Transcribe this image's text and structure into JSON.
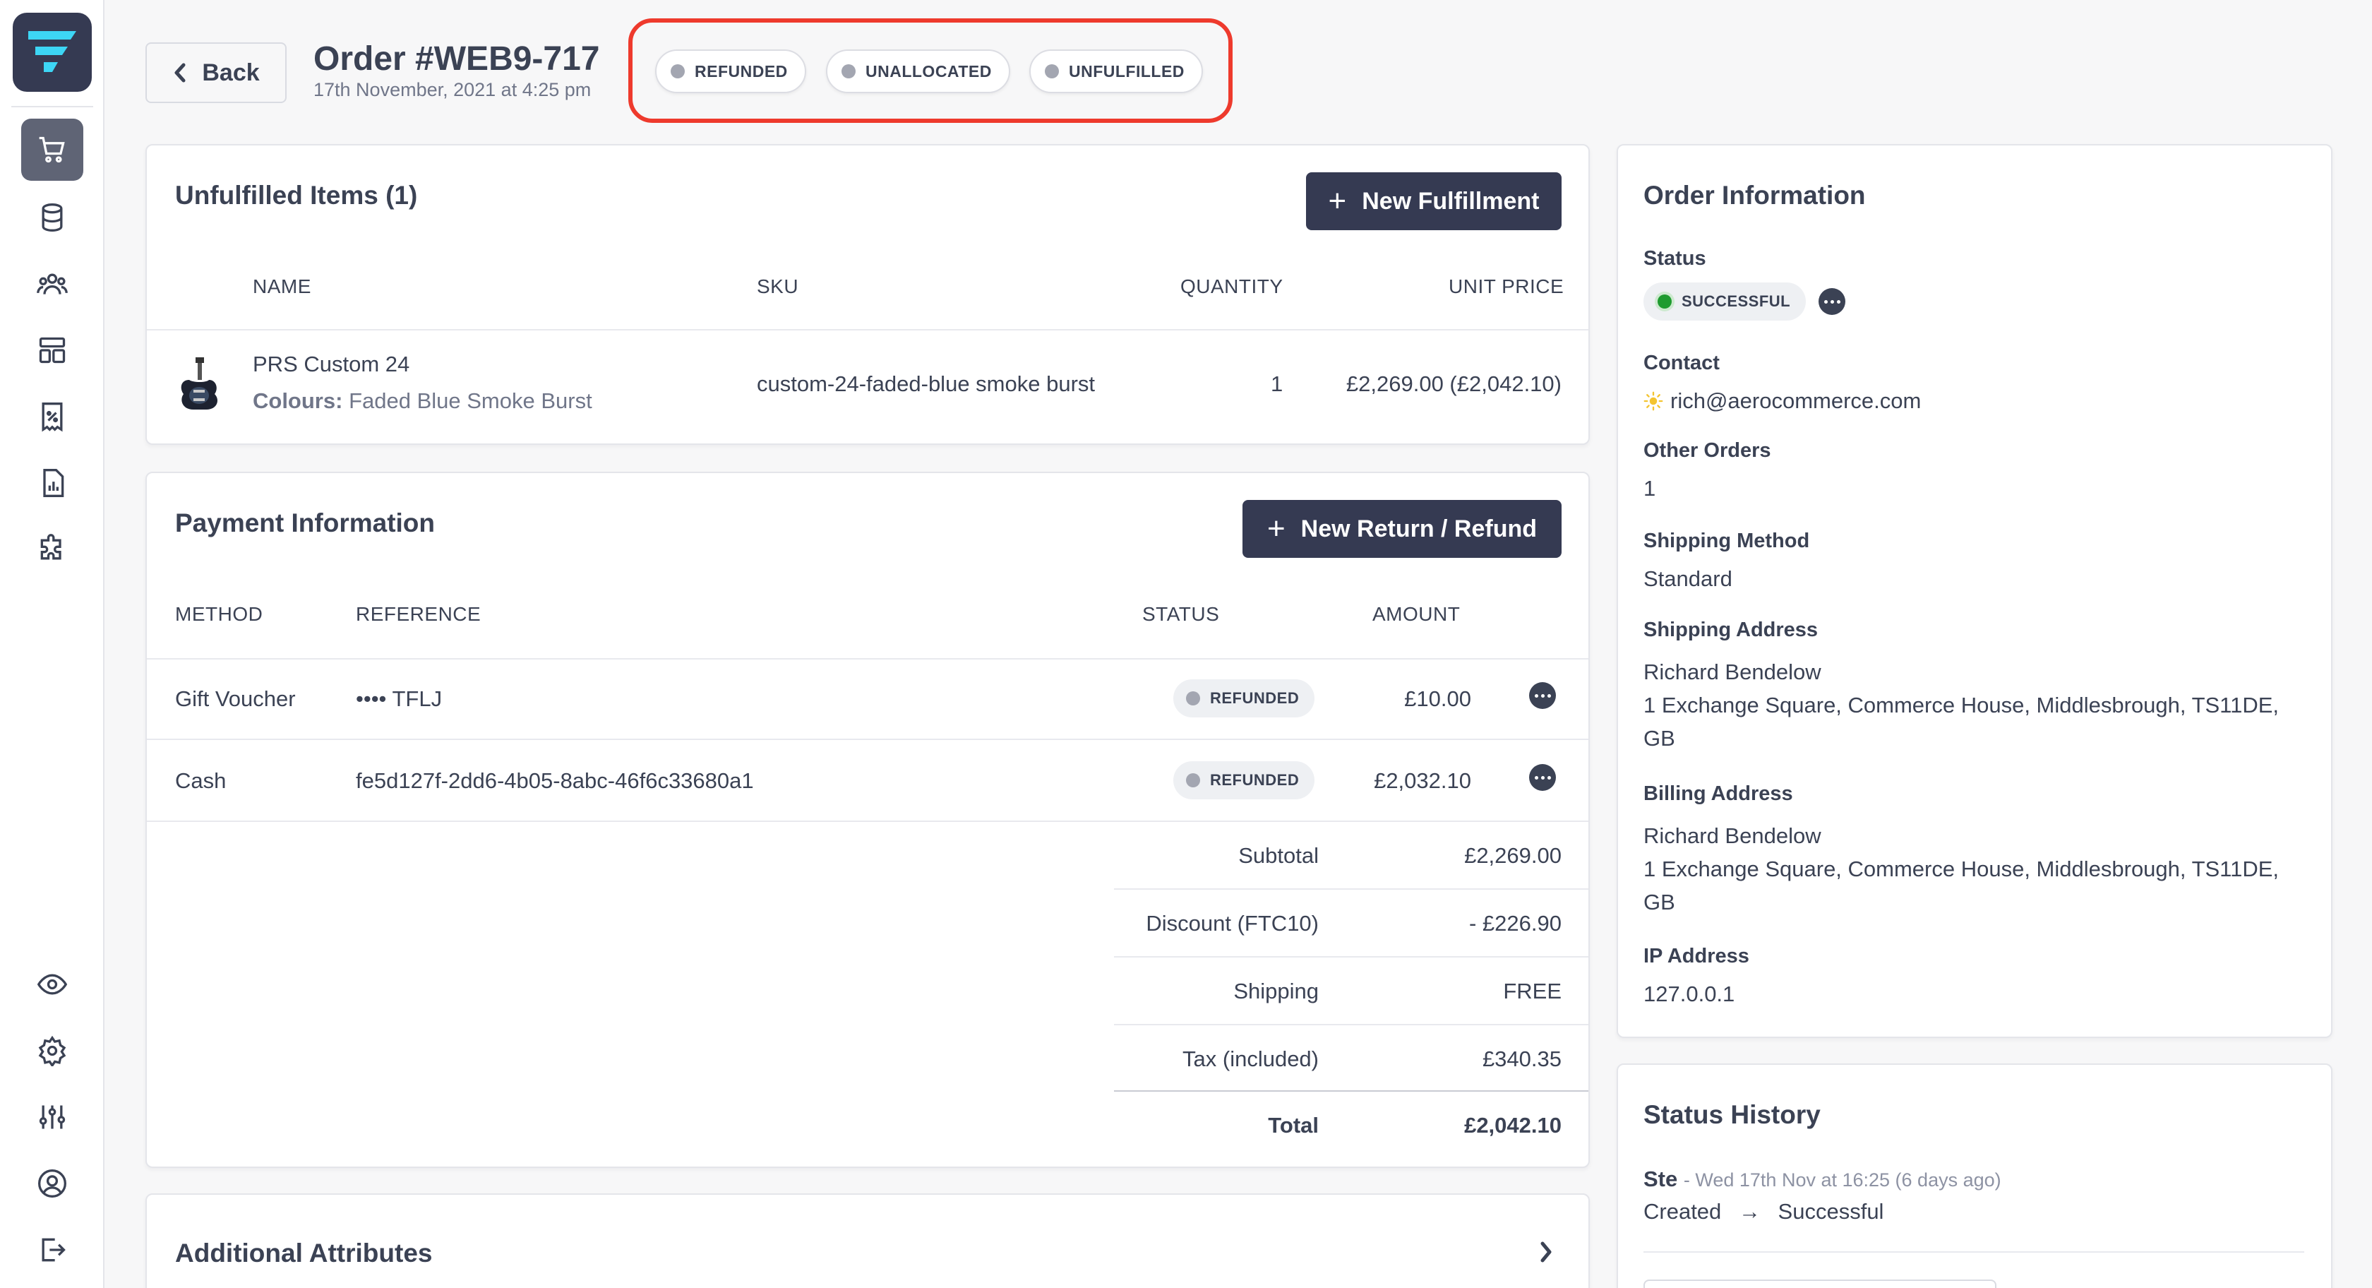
{
  "header": {
    "back_label": "Back",
    "order_title": "Order #WEB9-717",
    "order_date": "17th November, 2021 at 4:25 pm",
    "badges": [
      "REFUNDED",
      "UNALLOCATED",
      "UNFULFILLED"
    ]
  },
  "sidebar": {
    "icons": [
      "cart-icon",
      "database-icon",
      "customers-icon",
      "layout-icon",
      "discount-icon",
      "reports-icon",
      "extensions-icon",
      "eye-icon",
      "settings-icon",
      "sliders-icon",
      "account-icon",
      "logout-icon"
    ]
  },
  "unfulfilled": {
    "title": "Unfulfilled Items (1)",
    "new_button": "New Fulfillment",
    "columns": [
      "NAME",
      "SKU",
      "QUANTITY",
      "UNIT PRICE"
    ],
    "items": [
      {
        "name": "PRS Custom 24",
        "option_label": "Colours:",
        "option_value": "Faded Blue Smoke Burst",
        "sku": "custom-24-faded-blue smoke burst",
        "quantity": "1",
        "unit_price": "£2,269.00 (£2,042.10)"
      }
    ]
  },
  "payment": {
    "title": "Payment Information",
    "new_button": "New Return / Refund",
    "columns": [
      "METHOD",
      "REFERENCE",
      "STATUS",
      "AMOUNT"
    ],
    "rows": [
      {
        "method": "Gift Voucher",
        "reference": "•••• TFLJ",
        "status": "REFUNDED",
        "amount": "£10.00"
      },
      {
        "method": "Cash",
        "reference": "fe5d127f-2dd6-4b05-8abc-46f6c33680a1",
        "status": "REFUNDED",
        "amount": "£2,032.10"
      }
    ],
    "totals": [
      {
        "label": "Subtotal",
        "value": "£2,269.00"
      },
      {
        "label": "Discount (FTC10)",
        "value": "- £226.90"
      },
      {
        "label": "Shipping",
        "value": "FREE"
      },
      {
        "label": "Tax (included)",
        "value": "£340.35"
      },
      {
        "label": "Total",
        "value": "£2,042.10"
      }
    ]
  },
  "additional": {
    "title": "Additional Attributes"
  },
  "order_info": {
    "title": "Order Information",
    "status_label": "Status",
    "status_value": "SUCCESSFUL",
    "contact_label": "Contact",
    "contact_value": "rich@aerocommerce.com",
    "other_orders_label": "Other Orders",
    "other_orders_value": "1",
    "shipping_method_label": "Shipping Method",
    "shipping_method_value": "Standard",
    "shipping_address_label": "Shipping Address",
    "shipping_address_lines": [
      "Richard Bendelow",
      "1 Exchange Square, Commerce House, Middlesbrough, TS11DE,",
      "GB"
    ],
    "billing_address_label": "Billing Address",
    "billing_address_lines": [
      "Richard Bendelow",
      "1 Exchange Square, Commerce House, Middlesbrough, TS11DE,",
      "GB"
    ],
    "ip_label": "IP Address",
    "ip_value": "127.0.0.1"
  },
  "status_history": {
    "title": "Status History",
    "entries": [
      {
        "user": "Ste",
        "time": "- Wed 17th Nov at 16:25 (6 days ago)",
        "from": "Created",
        "to": "Successful"
      }
    ]
  },
  "colors": {
    "primary": "#353a52",
    "highlight": "#ee3a2d",
    "success": "#1e9b2f",
    "neutral_dot": "#a3a6b1"
  }
}
